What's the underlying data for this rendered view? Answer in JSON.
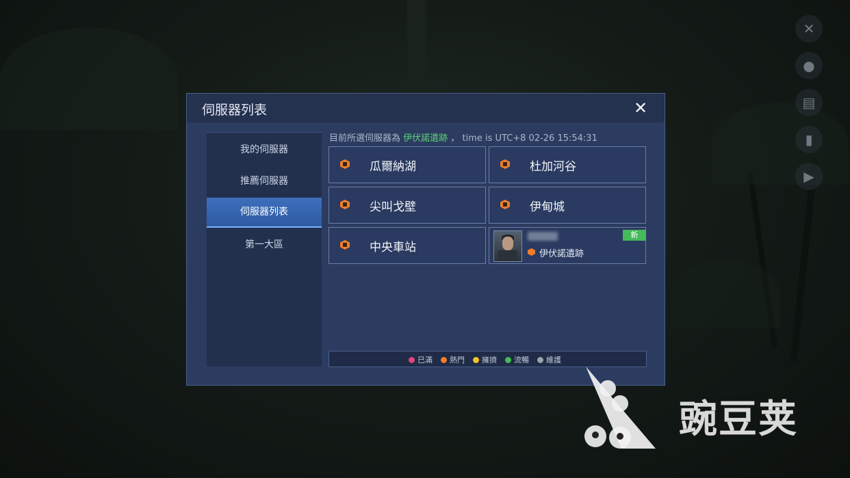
{
  "panel": {
    "title": "伺服器列表",
    "close_icon": "close-icon"
  },
  "sidebar": {
    "items": [
      {
        "label": "我的伺服器",
        "active": false
      },
      {
        "label": "推薦伺服器",
        "active": false
      },
      {
        "label": "伺服器列表",
        "active": true
      },
      {
        "label": "第一大區",
        "active": false
      }
    ]
  },
  "status": {
    "prefix": "目前所選伺服器為",
    "selected_server": "伊伏諾遺跡",
    "separator": "，",
    "time_text": "time is UTC+8 02-26 15:54:31"
  },
  "servers": [
    {
      "name": "瓜爾納湖",
      "status_color": "#f07d2c"
    },
    {
      "name": "杜加河谷",
      "status_color": "#f07d2c"
    },
    {
      "name": "尖叫戈壁",
      "status_color": "#f07d2c"
    },
    {
      "name": "伊甸城",
      "status_color": "#f07d2c"
    },
    {
      "name": "中央車站",
      "status_color": "#f07d2c"
    }
  ],
  "character_card": {
    "badge": "新",
    "server": "伊伏諾遺跡",
    "status_color": "#f07d2c"
  },
  "legend": [
    {
      "label": "已滿",
      "color": "#e0457a"
    },
    {
      "label": "熱門",
      "color": "#f07d2c"
    },
    {
      "label": "擁擠",
      "color": "#f2c230"
    },
    {
      "label": "流暢",
      "color": "#46b95c"
    },
    {
      "label": "維護",
      "color": "#9aa3ad"
    }
  ],
  "watermark": {
    "text": "豌豆荚"
  },
  "hud_icons": [
    "wrench-icon",
    "person-icon",
    "clipboard-icon",
    "microphone-icon",
    "video-icon"
  ]
}
